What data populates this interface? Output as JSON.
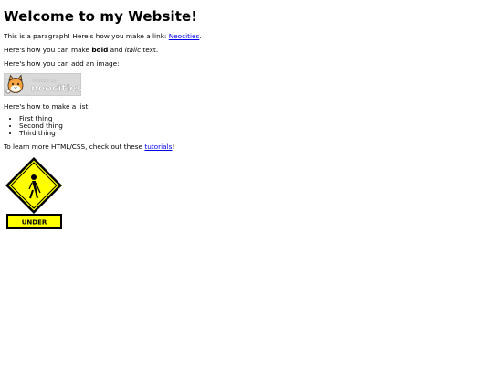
{
  "page": {
    "heading": "Welcome to my Website!",
    "paragraph_intro": "This is a paragraph! Here's how you make a link: ",
    "link_neocities": "Neocities",
    "paragraph_intro_end": ".",
    "bold_prefix": "Here's how you can make ",
    "bold_word": "bold",
    "bold_mid": " and ",
    "italic_word": "italic",
    "bold_suffix": " text.",
    "image_intro": "Here's how you can add an image:",
    "badge": {
      "small_text": "hosted by",
      "big_text": "neocities",
      "bg_color": "#d9d9d9",
      "text_color": "#ffffff",
      "icon": "neocities-cat-icon"
    },
    "list_intro": "Here's how to make a list:",
    "list_items": [
      "First thing",
      "Second thing",
      "Third thing"
    ],
    "learn_prefix": "To learn more HTML/CSS, check out these ",
    "link_tutorials": "tutorials",
    "learn_suffix": "!",
    "sign": {
      "label": "UNDER",
      "icon": "under-construction-sign-icon",
      "fill_color": "#ffff00",
      "border_color": "#000000"
    }
  }
}
